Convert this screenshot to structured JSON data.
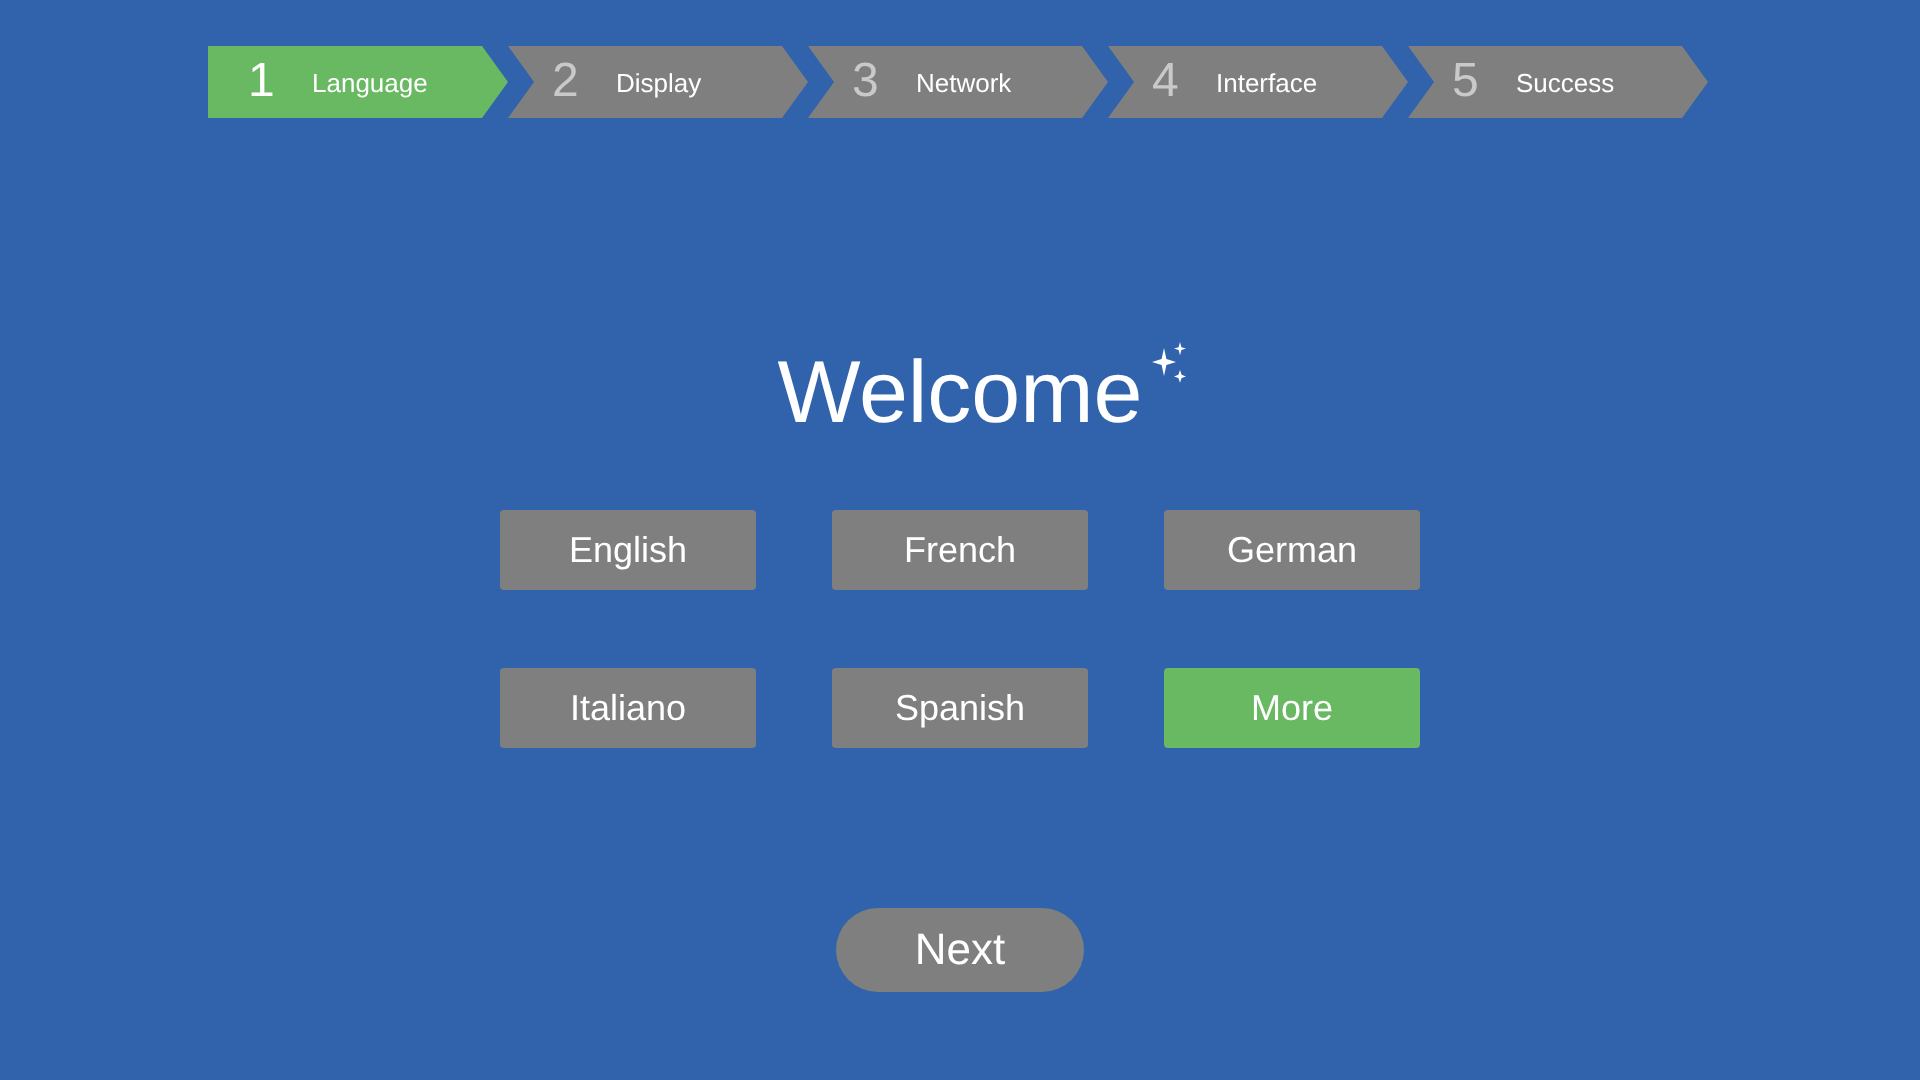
{
  "steps": [
    {
      "number": "1",
      "label": "Language",
      "selected": true
    },
    {
      "number": "2",
      "label": "Display",
      "selected": false
    },
    {
      "number": "3",
      "label": "Network",
      "selected": false
    },
    {
      "number": "4",
      "label": "Interface",
      "selected": false
    },
    {
      "number": "5",
      "label": "Success",
      "selected": false
    }
  ],
  "title": "Welcome",
  "languages": [
    {
      "label": "English",
      "selected": false
    },
    {
      "label": "French",
      "selected": false
    },
    {
      "label": "German",
      "selected": false
    },
    {
      "label": "Italiano",
      "selected": false
    },
    {
      "label": "Spanish",
      "selected": false
    },
    {
      "label": "More",
      "selected": true
    }
  ],
  "next_button": "Next"
}
